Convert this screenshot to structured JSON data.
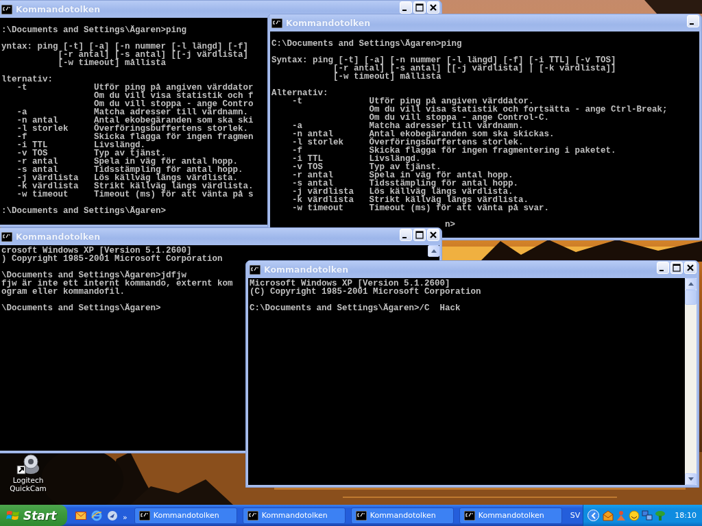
{
  "desktop_icons": [
    {
      "label": "Logitech QuickCam"
    }
  ],
  "windows": [
    {
      "title": "Kommandotolken",
      "buttons": [
        {
          "kind": "minimize"
        },
        {
          "kind": "maximize"
        },
        {
          "kind": "close"
        }
      ],
      "blocks": [
        [
          ":\\Documents and Settings\\Ägaren>ping"
        ],
        [
          "yntax: ping [-t] [-a] [-n nummer [-l längd] [-f]",
          "           [-r antal] [-s antal] [[-j värdlista]",
          "           [-w timeout] mållista"
        ],
        [
          "lternativ:",
          "   -t             Utför ping på angiven värddator",
          "                  Om du vill visa statistik och f",
          "                  Om du vill stoppa - ange Contro",
          "   -a             Matcha adresser till värdnamn.",
          "   -n antal       Antal ekobegäranden som ska ski",
          "   -l storlek     Överföringsbuffertens storlek.",
          "   -f             Skicka flagga för ingen fragmen",
          "   -i TTL         Livslängd.",
          "   -v TOS         Typ av tjänst.",
          "   -r antal       Spela in väg för antal hopp.",
          "   -s antal       Tidsstämpling för antal hopp.",
          "   -j värdlista   Lös källväg längs värdlista.",
          "   -k värdlista   Strikt källväg längs värdlista.",
          "   -w timeout     Timeout (ms) för att vänta på s"
        ],
        [
          ":\\Documents and Settings\\Ägaren>"
        ]
      ]
    },
    {
      "title": "Kommandotolken",
      "buttons": [
        {
          "kind": "minimize"
        }
      ],
      "blocks": [
        [
          "C:\\Documents and Settings\\Ägaren>ping"
        ],
        [
          "Syntax: ping [-t] [-a] [-n nummer [-l längd] [-f] [-i TTL] [-v TOS]",
          "            [-r antal] [-s antal] [[-j värdlista] | [-k värdlista]]",
          "            [-w timeout] mållista"
        ],
        [
          "Alternativ:",
          "    -t             Utför ping på angiven värddator.",
          "                   Om du vill visa statistik och fortsätta - ange Ctrl-Break;",
          "                   Om du vill stoppa - ange Control-C.",
          "    -a             Matcha adresser till värdnamn.",
          "    -n antal       Antal ekobegäranden som ska skickas.",
          "    -l storlek     Överföringsbuffertens storlek.",
          "    -f             Skicka flagga för ingen fragmentering i paketet.",
          "    -i TTL         Livslängd.",
          "    -v TOS         Typ av tjänst.",
          "    -r antal       Spela in väg för antal hopp.",
          "    -s antal       Tidsstämpling för antal hopp.",
          "    -j värdlista   Lös källväg längs värdlista.",
          "    -k värdlista   Strikt källväg längs värdlista.",
          "    -w timeout     Timeout (ms) för att vänta på svar."
        ],
        [
          "n>"
        ]
      ]
    },
    {
      "title": "Kommandotolken",
      "buttons": [
        {
          "kind": "minimize"
        },
        {
          "kind": "maximize"
        },
        {
          "kind": "close"
        }
      ],
      "scrollbar": {
        "kind": "top"
      },
      "blocks": [
        [
          "crosoft Windows XP [Version 5.1.2600]",
          ") Copyright 1985-2001 Microsoft Corporation"
        ],
        [
          "\\Documents and Settings\\Ägaren>jdfjw",
          "fjw är inte ett internt kommando, externt kom",
          "ogram eller kommandofil."
        ],
        [
          "\\Documents and Settings\\Ägaren>"
        ]
      ]
    },
    {
      "title": "Kommandotolken",
      "buttons": [
        {
          "kind": "minimize"
        },
        {
          "kind": "maximize"
        },
        {
          "kind": "close"
        }
      ],
      "scrollbar": {
        "kind": "full"
      },
      "blocks": [
        [
          "Microsoft Windows XP [Version 5.1.2600]",
          "(C) Copyright 1985-2001 Microsoft Corporation"
        ],
        [
          "C:\\Documents and Settings\\Ägaren>/C  Hack"
        ]
      ]
    }
  ],
  "taskbar": {
    "start": "Start",
    "more": "»",
    "language": "SV",
    "clock": "18:10",
    "tasks": [
      {
        "label": "Kommandotolken",
        "selected": false
      },
      {
        "label": "Kommandotolken",
        "selected": false
      },
      {
        "label": "Kommandotolken",
        "selected": false
      },
      {
        "label": "Kommandotolken",
        "selected": false
      }
    ]
  }
}
